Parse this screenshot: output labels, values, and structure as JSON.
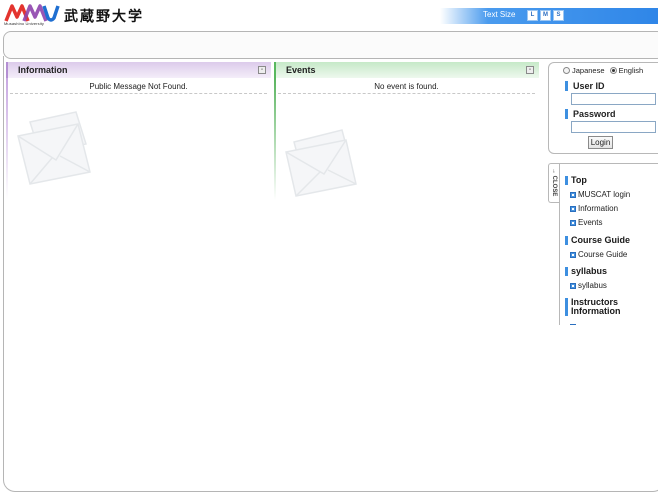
{
  "header": {
    "logo_sub": "Musashino University",
    "logo_jp": "武蔵野大学",
    "text_size_label": "Text Size",
    "text_size_buttons": [
      "L",
      "M",
      "S"
    ]
  },
  "information": {
    "title": "Information",
    "message": "Public Message Not Found.",
    "minimize_symbol": "-"
  },
  "events": {
    "title": "Events",
    "message": "No event is found.",
    "minimize_symbol": "-"
  },
  "login": {
    "languages": [
      {
        "label": "Japanese",
        "selected": false
      },
      {
        "label": "English",
        "selected": true
      }
    ],
    "user_id_label": "User ID",
    "user_id_value": "",
    "password_label": "Password",
    "password_value": "",
    "login_button": "Login"
  },
  "side_menu": {
    "close_label": "→ CLOSE",
    "sections": [
      {
        "heading": "Top",
        "items": [
          "MUSCAT login",
          "Information",
          "Events"
        ]
      },
      {
        "heading": "Course Guide",
        "items": [
          "Course Guide"
        ]
      },
      {
        "heading": "syllabus",
        "items": [
          "syllabus"
        ]
      },
      {
        "heading": "Instructors Information",
        "items": []
      }
    ]
  },
  "colors": {
    "accent_blue": "#3d8fe0",
    "info_purple": "#b48fd3",
    "events_green": "#58b85e",
    "text_size_bar": "#2f86e8"
  }
}
